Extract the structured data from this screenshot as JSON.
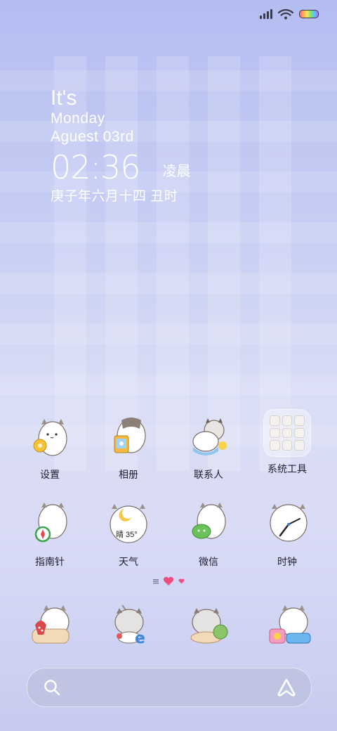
{
  "status_bar": {
    "signal_icon": "signal-bars-icon",
    "wifi_icon": "wifi-icon",
    "battery_icon": "battery-icon"
  },
  "widget": {
    "line1": "It's",
    "line2": "Monday",
    "line3": "Aguest 03rd",
    "time": "02:36",
    "period": "凌晨",
    "lunar": "庚子年六月十四 丑时"
  },
  "apps": [
    {
      "label": "设置",
      "icon": "settings-cat-icon"
    },
    {
      "label": "相册",
      "icon": "gallery-cat-icon"
    },
    {
      "label": "联系人",
      "icon": "contacts-cat-icon"
    },
    {
      "label": "系统工具",
      "icon": "system-tools-folder-icon"
    },
    {
      "label": "指南针",
      "icon": "compass-cat-icon"
    },
    {
      "label": "天气",
      "icon": "weather-cat-icon",
      "badge": "晴 35°"
    },
    {
      "label": "微信",
      "icon": "wechat-cat-icon"
    },
    {
      "label": "时钟",
      "icon": "clock-cat-icon"
    }
  ],
  "dock": [
    {
      "icon": "phone-cat-icon"
    },
    {
      "icon": "browser-cat-icon"
    },
    {
      "icon": "messages-cat-icon"
    },
    {
      "icon": "camera-cat-icon"
    }
  ],
  "search": {
    "icon": "search-icon",
    "assistant_icon": "assistant-icon"
  },
  "colors": {
    "accent_heart": "#ef4f7a",
    "text_dark": "#1f2030"
  }
}
